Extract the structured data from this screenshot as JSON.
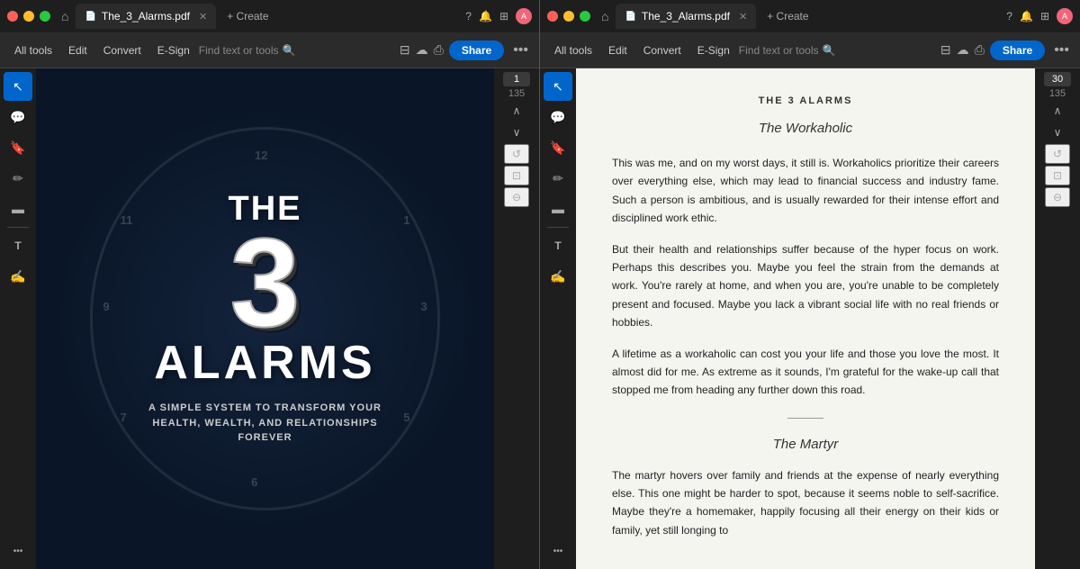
{
  "left": {
    "tab_bar": {
      "tab_label": "The_3_Alarms.pdf",
      "new_tab_label": "+ Create"
    },
    "toolbar": {
      "all_tools": "All tools",
      "edit": "Edit",
      "convert": "Convert",
      "esign": "E-Sign",
      "find_placeholder": "Find text or tools",
      "share": "Share"
    },
    "page_controls": {
      "current": "1",
      "total": "135"
    },
    "cover": {
      "the": "THE",
      "number": "3",
      "alarms": "ALARMS",
      "subtitle": "A SIMPLE SYSTEM TO TRANSFORM YOUR HEALTH, WEALTH, AND RELATIONSHIPS FOREVER"
    }
  },
  "right": {
    "tab_bar": {
      "tab_label": "The_3_Alarms.pdf",
      "new_tab_label": "+ Create"
    },
    "toolbar": {
      "all_tools": "All tools",
      "edit": "Edit",
      "convert": "Convert",
      "esign": "E-Sign",
      "find_placeholder": "Find text or tools",
      "share": "Share"
    },
    "page_controls": {
      "current": "30",
      "total": "135"
    },
    "content": {
      "chapter": "THE 3 ALARMS",
      "section1_title": "The Workaholic",
      "p1": "This was me, and on my worst days, it still is. Workaholics prioritize their careers over everything else, which may lead to financial success and industry fame. Such a person is ambitious, and is usually rewarded for their intense effort and disciplined work ethic.",
      "p2": "But their health and relationships suffer because of the hyper focus on work. Perhaps this describes you. Maybe you feel the strain from the demands at work. You're rarely at home, and when you are, you're unable to be completely present and focused. Maybe you lack a vibrant social life with no real friends or hobbies.",
      "p3": "A lifetime as a workaholic can cost you your life and those you love the most. It almost did for me. As extreme as it sounds, I'm grateful for the wake-up call that stopped me from heading any further down this road.",
      "section2_title": "The Martyr",
      "p4": "The martyr hovers over family and friends at the expense of nearly everything else. This one might be harder to spot, because it seems noble to self-sacrifice. Maybe they're a homemaker, happily focusing all their energy on their kids or family, yet still longing to"
    }
  },
  "icons": {
    "home": "⌂",
    "help": "?",
    "bell": "🔔",
    "apps": "⊞",
    "close": "✕",
    "chevron_up": "∧",
    "chevron_down": "∨",
    "refresh": "↺",
    "fit": "⊡",
    "zoom_out": "⊖",
    "cursor": "↖",
    "comment": "💬",
    "bookmark": "🔖",
    "highlight": "✏",
    "redact": "▬",
    "text_edit": "T",
    "stamp": "⊕",
    "more": "•••",
    "search": "🔍",
    "cloud": "☁",
    "print": "⎙",
    "panel": "⊟",
    "freehand": "✍",
    "link": "🔗"
  }
}
